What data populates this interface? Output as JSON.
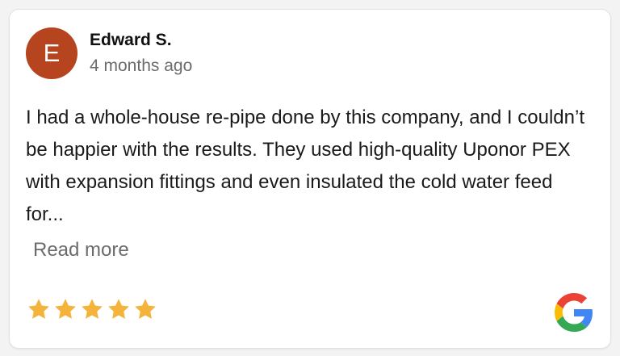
{
  "review": {
    "avatar_initial": "E",
    "avatar_color": "#b5441f",
    "author": "Edward S.",
    "date": "4 months ago",
    "text": "I had a whole-house re-pipe done by this company, and I couldn’t be happier with the results. They used high-quality Uponor PEX with expansion fittings and even insulated the cold water feed for...",
    "read_more_label": "Read more",
    "rating": 5,
    "rating_max": 5,
    "star_color": "#f4b43b",
    "source_icon": "google-icon"
  }
}
